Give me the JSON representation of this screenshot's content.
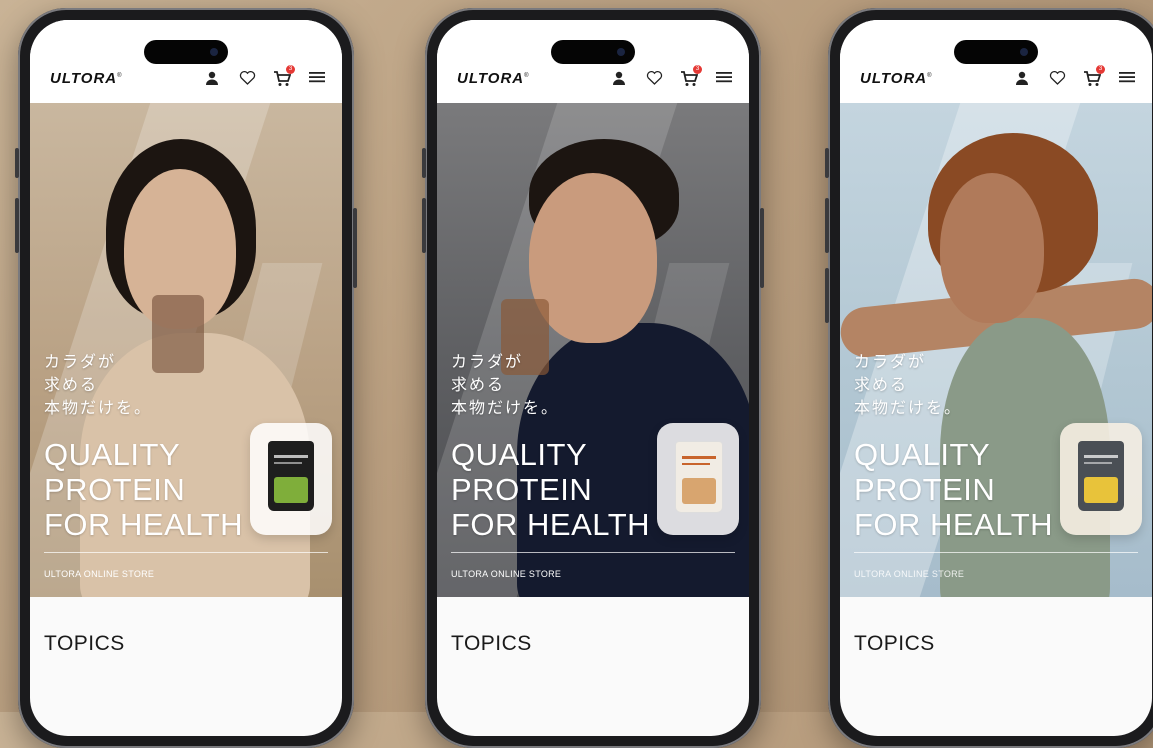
{
  "phones": [
    {
      "logo": "ULTORA",
      "logo_mark": "®",
      "cart_badge": "3",
      "hero_jp": [
        "カラダが",
        "求める",
        "本物だけを。"
      ],
      "headline": [
        "QUALITY",
        "PROTEIN",
        "FOR HEALTH"
      ],
      "store_label": "ULTORA ONLINE STORE",
      "section_title": "TOPICS",
      "hero_bg": "#c8b49c",
      "pouch_color": "#1e1e1e",
      "pouch_accent": "#7fae3a"
    },
    {
      "logo": "ULTORA",
      "logo_mark": "®",
      "cart_badge": "3",
      "hero_jp": [
        "カラダが",
        "求める",
        "本物だけを。"
      ],
      "headline": [
        "QUALITY",
        "PROTEIN",
        "FOR HEALTH"
      ],
      "store_label": "ULTORA ONLINE STORE",
      "section_title": "TOPICS",
      "hero_bg": "#6d6d6f",
      "pouch_color": "#f1ece4",
      "pouch_accent": "#c8642c"
    },
    {
      "logo": "ULTORA",
      "logo_mark": "®",
      "cart_badge": "3",
      "hero_jp": [
        "カラダが",
        "求める",
        "本物だけを。"
      ],
      "headline": [
        "QUALITY",
        "PROTEIN",
        "FOR HEALTH"
      ],
      "store_label": "ULTORA ONLINE STORE",
      "section_title": "TOPICS",
      "hero_bg": "#b8ccd8",
      "pouch_color": "#4a4f55",
      "pouch_accent": "#e8c33a"
    }
  ],
  "icons": [
    "account-icon",
    "heart-icon",
    "cart-icon",
    "menu-icon"
  ]
}
